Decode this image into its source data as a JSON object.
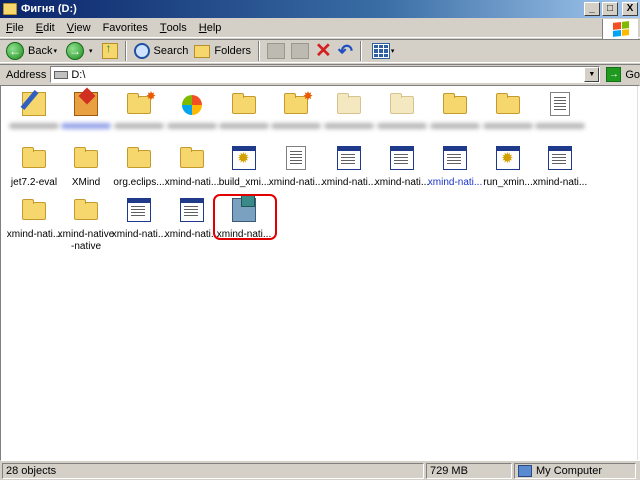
{
  "window": {
    "title": "Фигня (D:)",
    "min": "_",
    "max": "□",
    "close": "X"
  },
  "menu": [
    {
      "key": "F",
      "rest": "ile"
    },
    {
      "key": "E",
      "rest": "dit"
    },
    {
      "key": "V",
      "rest": "iew"
    },
    {
      "key": "",
      "rest": "Favorites"
    },
    {
      "key": "T",
      "rest": "ools"
    },
    {
      "key": "H",
      "rest": "elp"
    }
  ],
  "toolbar": {
    "back": "Back",
    "forward_arrow": "→",
    "back_arrow": "←",
    "search": "Search",
    "folders": "Folders",
    "delete": "✕",
    "undo": "↶",
    "dropdown": "▾"
  },
  "address": {
    "label": "Address",
    "value": "D:\\",
    "go": "Go",
    "go_arrow": "→",
    "drop": "▼"
  },
  "files_row1": [
    {
      "icon": "pencil-folder-icon",
      "label": ""
    },
    {
      "icon": "red-folder-icon",
      "label": ""
    },
    {
      "icon": "folder-star-icon",
      "label": ""
    },
    {
      "icon": "msn-icon",
      "label": ""
    },
    {
      "icon": "folder-icon",
      "label": ""
    },
    {
      "icon": "folder-star-icon",
      "label": ""
    },
    {
      "icon": "folder-pale-icon",
      "label": ""
    },
    {
      "icon": "folder-pale-icon",
      "label": ""
    },
    {
      "icon": "folder-icon",
      "label": ""
    },
    {
      "icon": "folder-icon",
      "label": ""
    },
    {
      "icon": "document-icon",
      "label": ""
    }
  ],
  "files_row2": [
    {
      "icon": "folder-icon",
      "label": "jet7.2-eval"
    },
    {
      "icon": "folder-icon",
      "label": "XMind"
    },
    {
      "icon": "folder-icon",
      "label": "org.eclips..."
    },
    {
      "icon": "folder-icon",
      "label": "xmind-nati..."
    },
    {
      "icon": "gear-window-icon",
      "label": "build_xmi..."
    },
    {
      "icon": "document-icon",
      "label": "xmind-nati..."
    },
    {
      "icon": "sheet-icon",
      "label": "xmind-nati..."
    },
    {
      "icon": "sheet-icon",
      "label": "xmind-nati..."
    },
    {
      "icon": "sheet-icon",
      "label": "xmind-nati..."
    },
    {
      "icon": "gear-window-icon",
      "label": "run_xmin..."
    },
    {
      "icon": "sheet-icon",
      "label": "xmind-nati..."
    }
  ],
  "files_row3": [
    {
      "icon": "folder-icon",
      "label": "xmind-nati..."
    },
    {
      "icon": "folder-icon",
      "label": "xmind-native -native"
    },
    {
      "icon": "sheet-icon",
      "label": "xmind-nati..."
    },
    {
      "icon": "sheet-icon",
      "label": "xmind-nati..."
    },
    {
      "icon": "installer-icon",
      "label": "xmind-nati..."
    }
  ],
  "status": {
    "objects": "28 objects",
    "size": "729 MB",
    "location": "My Computer"
  }
}
